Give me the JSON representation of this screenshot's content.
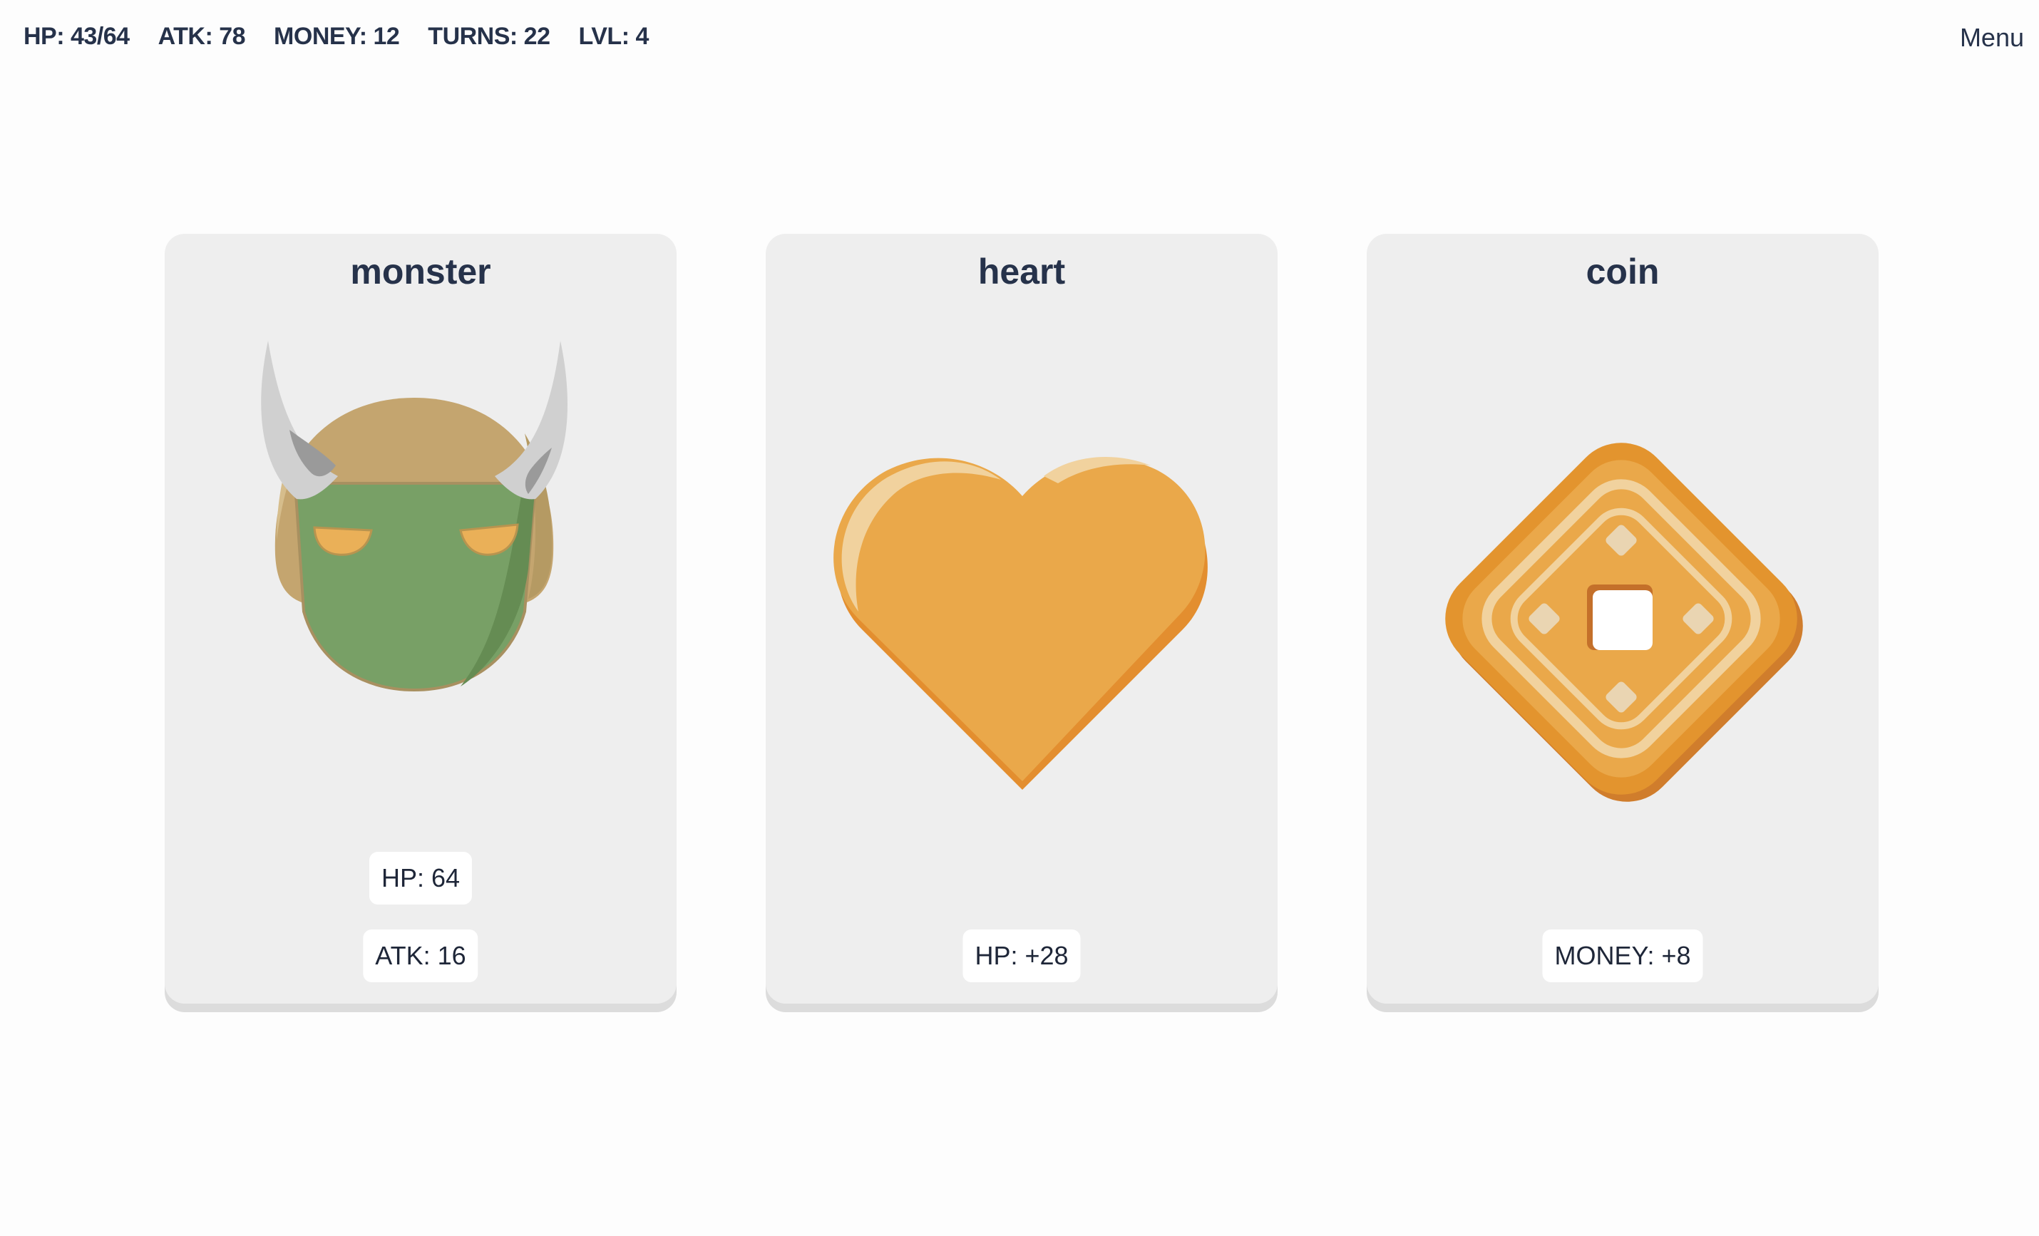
{
  "hud": {
    "hp": "HP: 43/64",
    "atk": "ATK: 78",
    "money": "MONEY: 12",
    "turns": "TURNS: 22",
    "lvl": "LVL: 4",
    "menu_label": "Menu"
  },
  "cards": [
    {
      "title": "monster",
      "icon": "horned-helmet-monster-icon",
      "stats": [
        "HP: 64",
        "ATK: 16"
      ]
    },
    {
      "title": "heart",
      "icon": "heart-icon",
      "stats": [
        "HP: +28"
      ]
    },
    {
      "title": "coin",
      "icon": "coin-icon",
      "stats": [
        "MONEY: +8"
      ]
    }
  ],
  "colors": {
    "text": "#26324a",
    "card_bg": "#eeeeee",
    "card_shadow": "#dcdcdc",
    "gold": "#eaa84a",
    "helmet": "#c4a56f",
    "monster_face": "#78a066",
    "horn": "#cfcfcf"
  }
}
